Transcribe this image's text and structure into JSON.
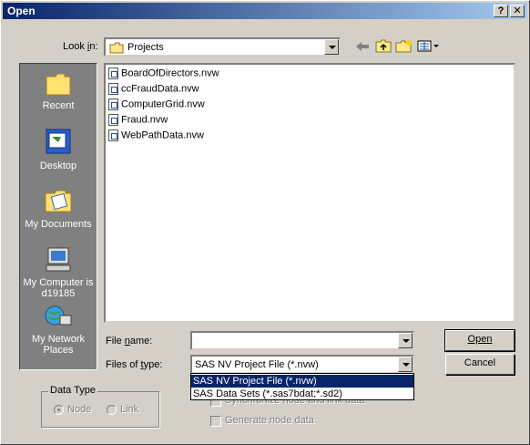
{
  "window": {
    "title": "Open",
    "help_button": "?",
    "close_button": "✕"
  },
  "look_in": {
    "label_pre": "Look ",
    "label_u": "i",
    "label_post": "n:",
    "value": "Projects"
  },
  "places": [
    {
      "label": "Recent",
      "icon": "recent-folder-icon"
    },
    {
      "label": "Desktop",
      "icon": "desktop-icon"
    },
    {
      "label": "My Documents",
      "icon": "my-documents-icon"
    },
    {
      "label": "My Computer is d19185",
      "icon": "my-computer-icon"
    },
    {
      "label": "My Network Places",
      "icon": "network-places-icon"
    }
  ],
  "files": [
    "BoardOfDirectors.nvw",
    "ccFraudData.nvw",
    "ComputerGrid.nvw",
    "Fraud.nvw",
    "WebPathData.nvw"
  ],
  "file_name": {
    "label_pre": "File ",
    "label_u": "n",
    "label_post": "ame:",
    "value": ""
  },
  "files_of_type": {
    "label_pre": "Files of ",
    "label_u": "t",
    "label_post": "ype:",
    "value": "SAS NV Project File (*.nvw)",
    "options": [
      "SAS NV Project File (*.nvw)",
      "SAS Data Sets (*.sas7bdat;*.sd2)"
    ]
  },
  "buttons": {
    "open": "Open",
    "cancel": "Cancel"
  },
  "data_type": {
    "title": "Data Type",
    "node": "Node",
    "link": "Link"
  },
  "checkboxes": {
    "synchronize": "Synchronize node and link data",
    "generate": "Generate node data"
  },
  "colors": {
    "title_start": "#0a246a",
    "title_end": "#a6caf0",
    "selection": "#0a246a",
    "face": "#d4d0c8"
  }
}
